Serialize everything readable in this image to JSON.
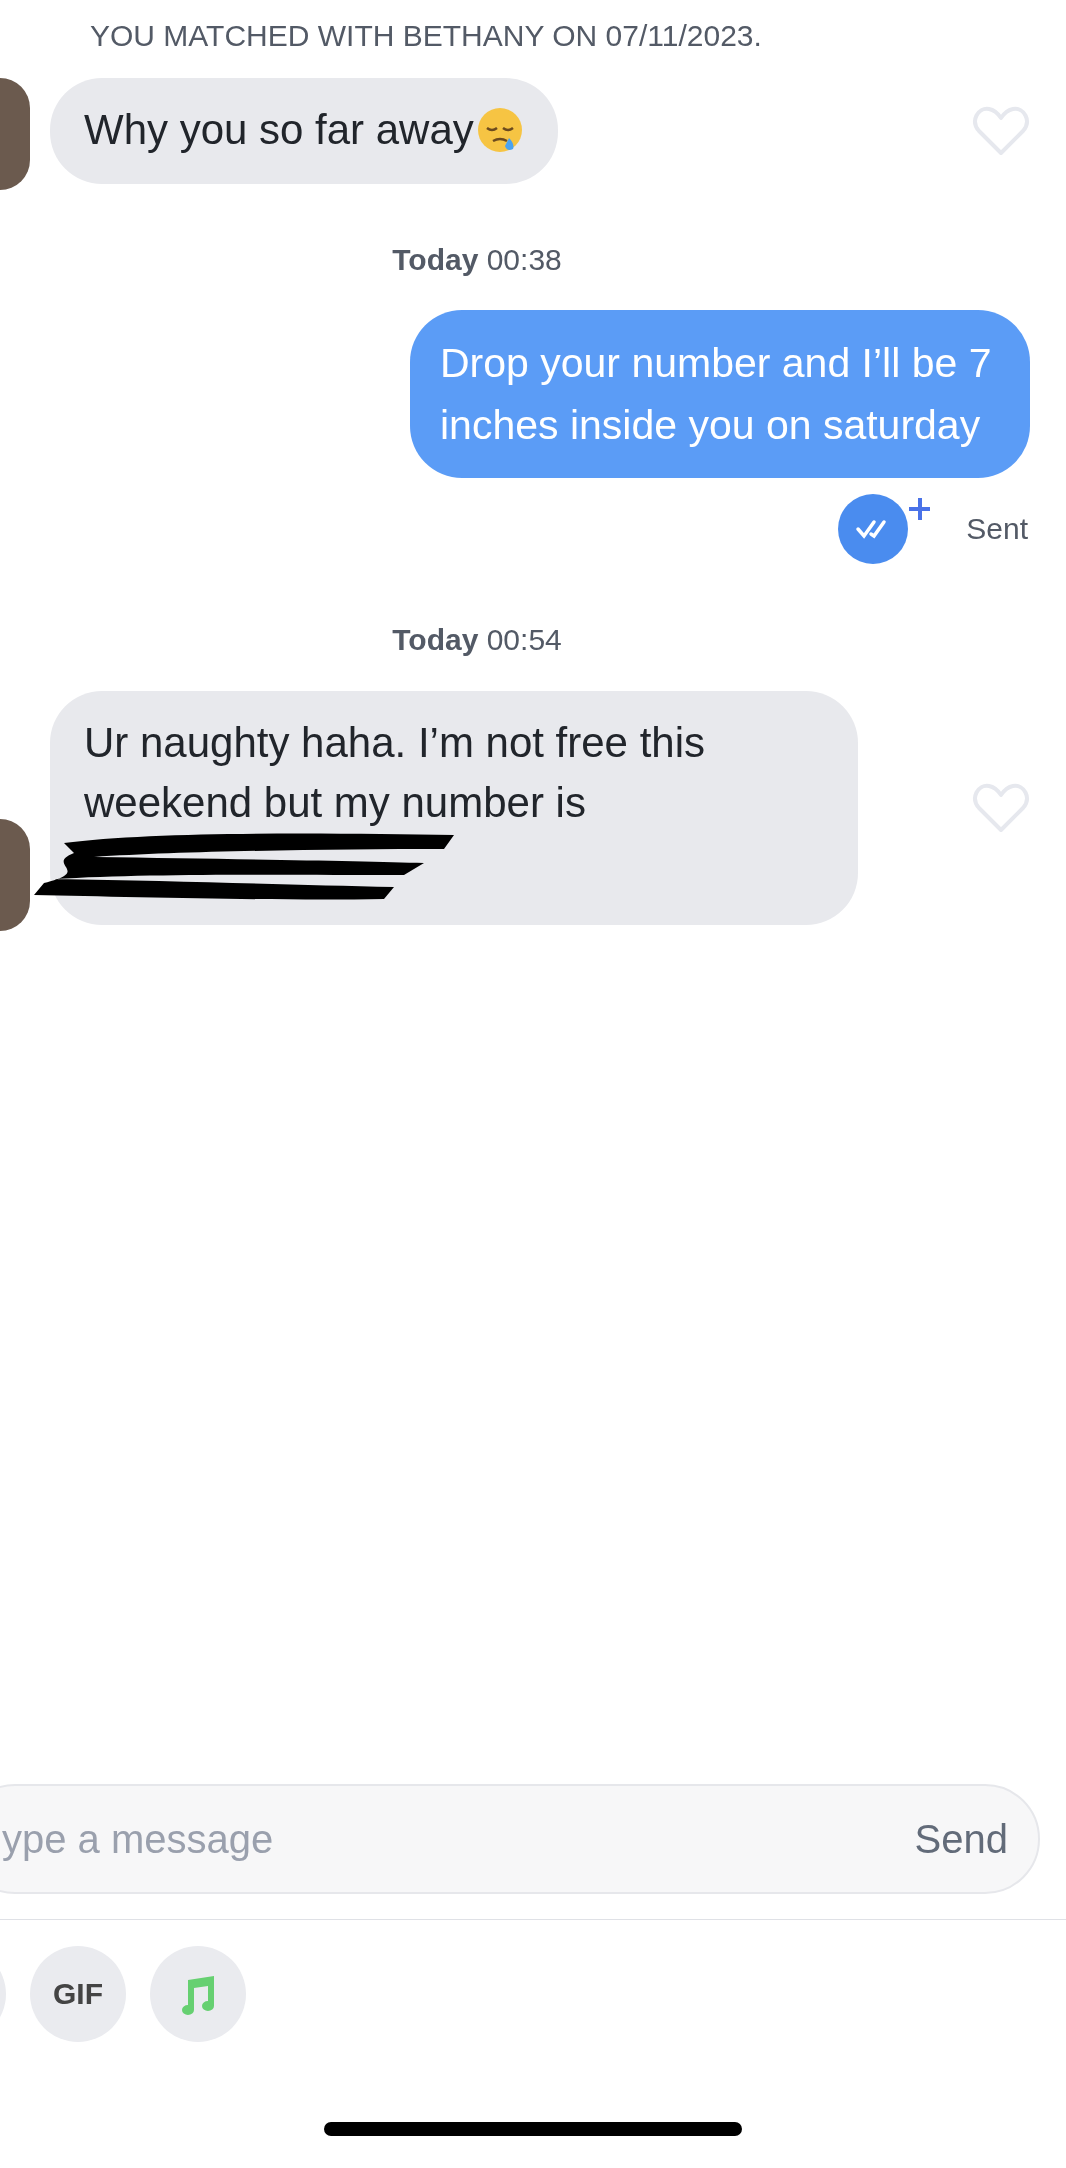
{
  "match_banner": "YOU MATCHED WITH BETHANY ON 07/11/2023.",
  "messages": [
    {
      "kind": "received",
      "text": "Why you so far away",
      "trailing_icon": true,
      "liked": false,
      "redacted": false
    },
    {
      "kind": "timestamp",
      "day": "Today",
      "time": "00:38"
    },
    {
      "kind": "sent",
      "text": "Drop your number and I’ll be 7 inches inside you on saturday",
      "status": "Sent",
      "read": true
    },
    {
      "kind": "timestamp",
      "day": "Today",
      "time": "00:54"
    },
    {
      "kind": "received",
      "text": "Ur naughty haha. I’m not free this weekend but my number is",
      "trailing_icon": false,
      "liked": false,
      "redacted": true
    }
  ],
  "composer": {
    "placeholder": "ype a message",
    "send_label": "Send"
  },
  "tools": [
    {
      "kind": "blank"
    },
    {
      "kind": "gif",
      "label": "GIF"
    },
    {
      "kind": "music"
    }
  ]
}
